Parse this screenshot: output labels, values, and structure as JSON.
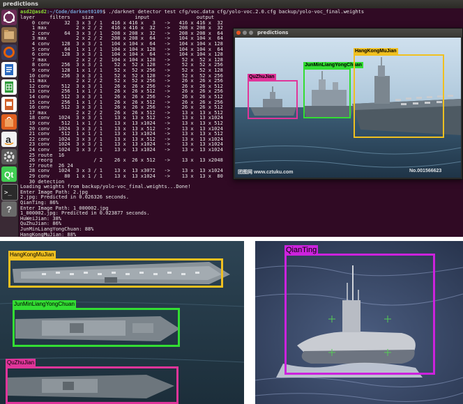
{
  "window_title": "predictions",
  "terminal": {
    "title": "predictions",
    "prompt_user": "asd2@asd2",
    "prompt_path": ":~/Code/darknet0109",
    "command": "$ ./darknet detector test cfg/voc.data cfg/yolo-voc.2.0.cfg backup/yolo-voc_final.weights",
    "lines": [
      "layer     filters    size              input                output",
      "    0 conv     32  3 x 3 / 1   416 x 416 x   3   ->   416 x 416 x  32",
      "    1 max          2 x 2 / 2   416 x 416 x  32   ->   208 x 208 x  32",
      "    2 conv     64  3 x 3 / 1   208 x 208 x  32   ->   208 x 208 x  64",
      "    3 max          2 x 2 / 2   208 x 208 x  64   ->   104 x 104 x  64",
      "    4 conv    128  3 x 3 / 1   104 x 104 x  64   ->   104 x 104 x 128",
      "    5 conv     64  1 x 1 / 1   104 x 104 x 128   ->   104 x 104 x  64",
      "    6 conv    128  3 x 3 / 1   104 x 104 x  64   ->   104 x 104 x 128",
      "    7 max          2 x 2 / 2   104 x 104 x 128   ->    52 x  52 x 128",
      "    8 conv    256  3 x 3 / 1    52 x  52 x 128   ->    52 x  52 x 256",
      "    9 conv    128  1 x 1 / 1    52 x  52 x 256   ->    52 x  52 x 128",
      "   10 conv    256  3 x 3 / 1    52 x  52 x 128   ->    52 x  52 x 256",
      "   11 max          2 x 2 / 2    52 x  52 x 256   ->    26 x  26 x 256",
      "   12 conv    512  3 x 3 / 1    26 x  26 x 256   ->    26 x  26 x 512",
      "   13 conv    256  1 x 1 / 1    26 x  26 x 512   ->    26 x  26 x 256",
      "   14 conv    512  3 x 3 / 1    26 x  26 x 256   ->    26 x  26 x 512",
      "   15 conv    256  1 x 1 / 1    26 x  26 x 512   ->    26 x  26 x 256",
      "   16 conv    512  3 x 3 / 1    26 x  26 x 256   ->    26 x  26 x 512",
      "   17 max          2 x 2 / 2    26 x  26 x 512   ->    13 x  13 x 512",
      "   18 conv   1024  3 x 3 / 1    13 x  13 x 512   ->    13 x  13 x1024",
      "   19 conv    512  1 x 1 / 1    13 x  13 x1024   ->    13 x  13 x 512",
      "   20 conv   1024  3 x 3 / 1    13 x  13 x 512   ->    13 x  13 x1024",
      "   21 conv    512  1 x 1 / 1    13 x  13 x1024   ->    13 x  13 x 512",
      "   22 conv   1024  3 x 3 / 1    13 x  13 x 512   ->    13 x  13 x1024",
      "   23 conv   1024  3 x 3 / 1    13 x  13 x1024   ->    13 x  13 x1024",
      "   24 conv   1024  3 x 3 / 1    13 x  13 x1024   ->    13 x  13 x1024",
      "   25 route  16",
      "   26 reorg              / 2    26 x  26 x 512   ->    13 x  13 x2048",
      "   27 route  26 24",
      "   28 conv   1024  3 x 3 / 1    13 x  13 x3072   ->    13 x  13 x1024",
      "   29 conv     80  1 x 1 / 1    13 x  13 x1024   ->    13 x  13 x  80",
      "   30 detection",
      "Loading weights from backup/yolo-voc_final.weights...Done!",
      "Enter Image Path: 2.jpg",
      "2.jpg: Predicted in 0.026326 seconds.",
      "QianTing: 86%",
      "Enter Image Path: 1_000002.jpg",
      "1_000002.jpg: Predicted in 0.023877 seconds.",
      "HuWeiJian: 38%",
      "QuZhuJian: 86%",
      "JunMinLiangYongChuan: 88%",
      "HangKongMuJian: 88%"
    ]
  },
  "prediction_window": {
    "labels": {
      "hangkong": "HangKongMuJian",
      "junmin": "JunMinLiangYongChuan",
      "quzhu": "QuZhuJian"
    },
    "watermark_left": "团图网 www.cztuku.com",
    "watermark_right": "No.001566623"
  },
  "bottom_left": {
    "labels": {
      "hangkong": "HangKongMuJian",
      "junmin": "JunMinLiangYongChuan",
      "quzhu": "QuZhuJian"
    }
  },
  "bottom_right": {
    "label": "QianTing"
  },
  "colors": {
    "hangkong": "#f0c020",
    "junmin": "#33dd33",
    "quzhu": "#e0359a",
    "qianting": "#cc22dd",
    "terminal_bg": "#300a24",
    "prompt_green": "#8ae234",
    "prompt_blue": "#729fcf"
  },
  "launcher_icons": [
    "dash-icon",
    "files-icon",
    "firefox-icon",
    "writer-icon",
    "calc-icon",
    "impress-icon",
    "software-center-icon",
    "amazon-icon",
    "settings-icon",
    "qt-icon",
    "terminal-icon",
    "help-icon"
  ]
}
